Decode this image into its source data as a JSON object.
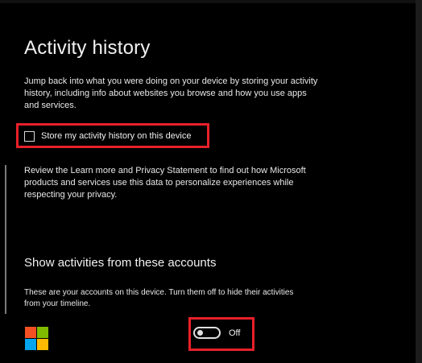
{
  "page": {
    "title": "Activity history",
    "description": "Jump back into what you were doing on your device by storing your activity history, including info about websites you browse and how you use apps and services."
  },
  "activity_checkbox": {
    "label": "Store my activity history on this device",
    "checked": false
  },
  "privacy": {
    "text": "Review the Learn more and Privacy Statement to find out how Microsoft products and services use this data to personalize experiences while respecting your privacy."
  },
  "accounts_section": {
    "heading": "Show activities from these accounts",
    "description": "These are your accounts on this device. Turn them off to hide their activities from your timeline.",
    "accounts": [
      {
        "icon": "microsoft-logo-icon",
        "toggle_state": "Off",
        "enabled": false
      }
    ]
  },
  "colors": {
    "background": "#000000",
    "highlight": "#e8202a",
    "text": "#ffffff",
    "logo_red": "#f25022",
    "logo_green": "#7fba00",
    "logo_blue": "#00a4ef",
    "logo_yellow": "#ffb900"
  }
}
